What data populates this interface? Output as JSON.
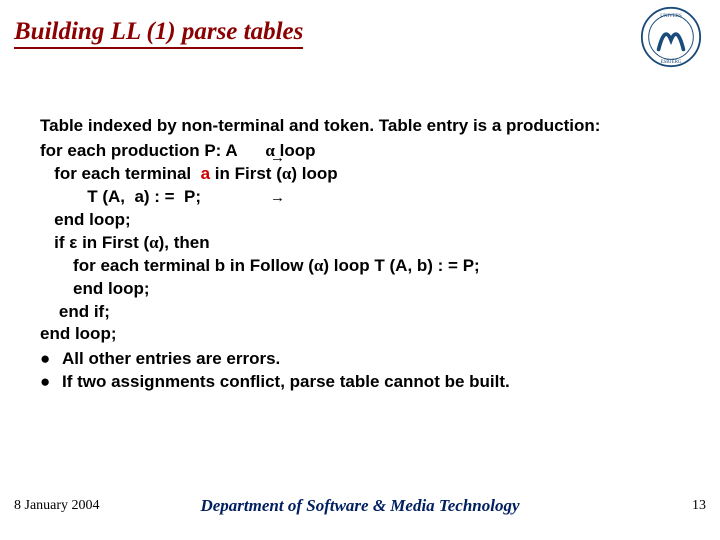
{
  "title": "Building  LL (1) parse tables",
  "intro": "Table indexed by non-terminal and token. Table entry is a production:",
  "code": {
    "l1a": "for each production P: A      ",
    "l1b": " loop",
    "l2a": "   for each terminal  ",
    "l2_a": "a",
    "l2b": " in First (",
    "l2c": ") loop",
    "l3": "          T (A,  a) : =  P;",
    "l4": "   end loop;",
    "l5a": "   if ",
    "l5eps": "ε",
    "l5b": " in First (",
    "l5c": "), then",
    "l6a": "       for each terminal b in Follow (",
    "l6b": ") loop T (A, b) : = P;",
    "l7": "       end loop;",
    "l8": "    end if;",
    "l9": "end loop;"
  },
  "alpha": "α",
  "bullets": [
    "All other entries are errors.",
    "If two assignments conflict, parse table cannot be built."
  ],
  "footer": {
    "date": "8 January 2004",
    "dept": "Department of Software & Media Technology",
    "page": "13"
  },
  "arrows": {
    "a1": "→",
    "a2": "→"
  }
}
